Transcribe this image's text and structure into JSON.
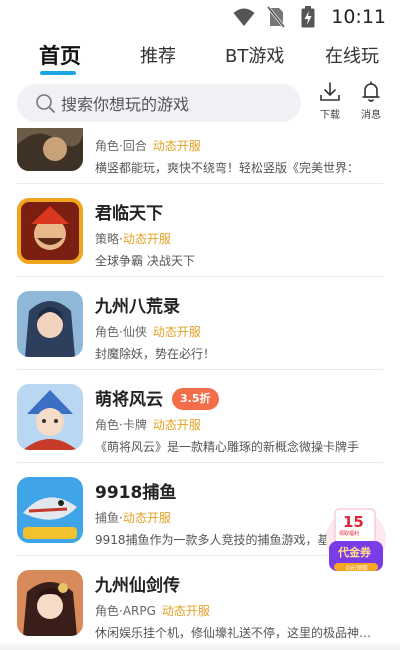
{
  "status_bar": {
    "time": "10:11",
    "icons": [
      "wifi-icon",
      "no-sim-icon",
      "battery-charging-icon"
    ]
  },
  "tabs": [
    {
      "label": "首页",
      "active": true
    },
    {
      "label": "推荐",
      "active": false
    },
    {
      "label": "BT游戏",
      "active": false
    },
    {
      "label": "在线玩",
      "active": false
    }
  ],
  "search": {
    "placeholder": "搜索你想玩的游戏",
    "icon": "search-icon"
  },
  "actions": {
    "download": {
      "label": "下载",
      "icon": "download-icon"
    },
    "messages": {
      "label": "消息",
      "icon": "bell-icon"
    }
  },
  "games": [
    {
      "name": "",
      "genre": "角色·回合",
      "open": "动态开服",
      "desc": "横竖都能玩，爽快不绕弯！轻松竖版《完美世界：",
      "badge": null
    },
    {
      "name": "君临天下",
      "genre": "策略·",
      "open": "动态开服",
      "desc": "全球争霸 决战天下",
      "badge": null
    },
    {
      "name": "九州八荒录",
      "genre": "角色·仙侠",
      "open": "动态开服",
      "desc": "封魔除妖，势在必行！",
      "badge": null
    },
    {
      "name": "萌将风云",
      "genre": "角色·卡牌",
      "open": "动态开服",
      "desc": "《萌将风云》是一款精心雕琢的新概念微操卡牌手",
      "badge": "3.5折"
    },
    {
      "name": "9918捕鱼",
      "genre": "捕鱼·",
      "open": "动态开服",
      "desc": "9918捕鱼作为一款多人竞技的捕鱼游戏，基",
      "badge": null
    },
    {
      "name": "九州仙剑传",
      "genre": "角色·ARPG",
      "open": "动态开服",
      "desc": "休闲娱乐挂个机，修仙壕礼送不停，这里的极品神…",
      "badge": null
    }
  ],
  "voucher": {
    "amount": "15",
    "label": "代金券",
    "sub": "0元领取",
    "tag": "领取福利"
  },
  "colors": {
    "accent": "#1ba6e6",
    "open_text": "#e2a121",
    "badge_bg": "#f36d4a"
  }
}
